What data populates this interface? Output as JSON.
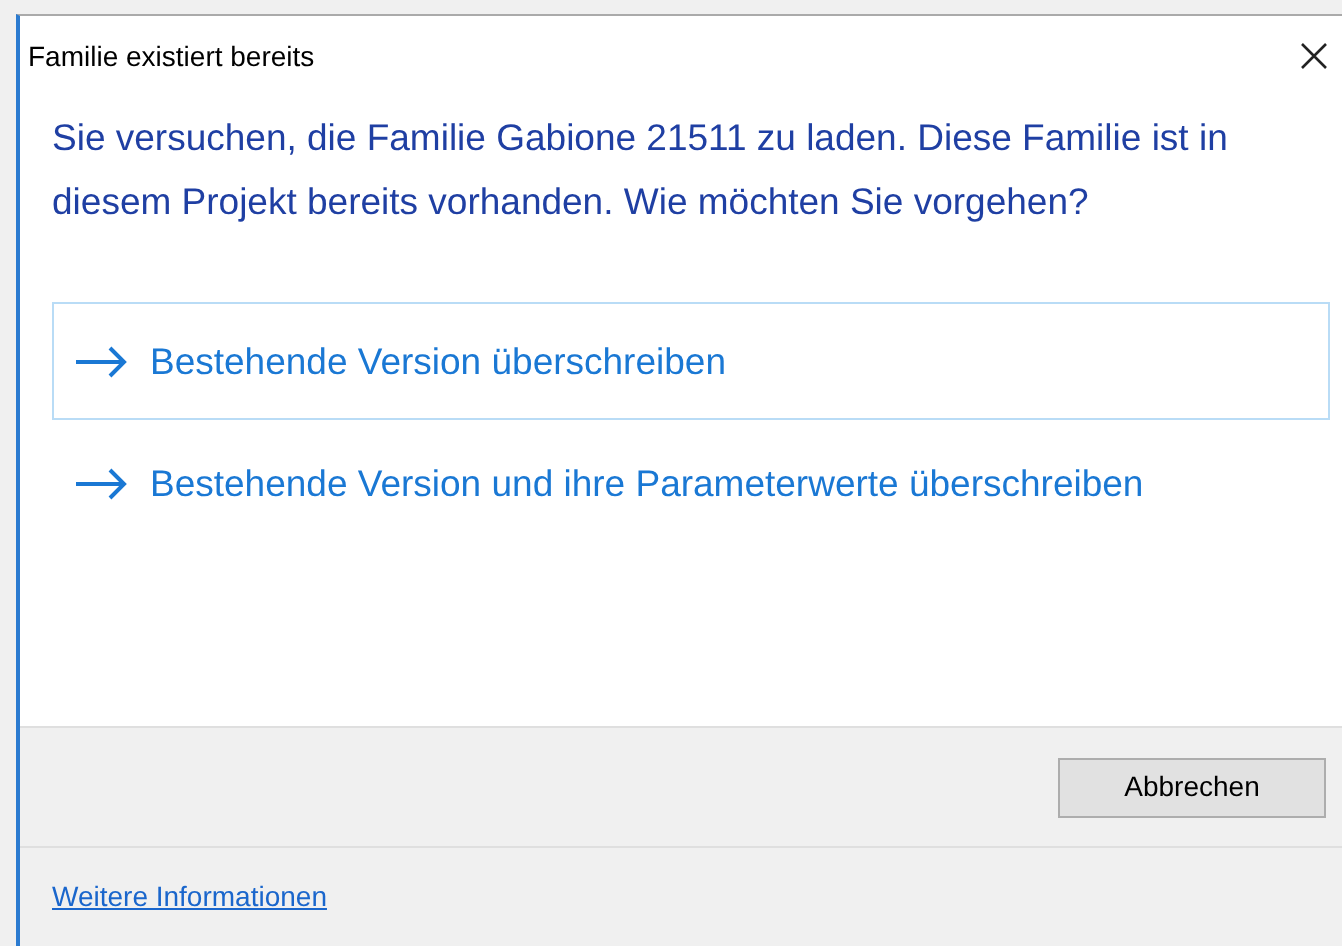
{
  "window": {
    "title": "Familie existiert bereits"
  },
  "instruction": "Sie versuchen, die Familie Gabione 21511 zu laden. Diese Familie ist in diesem Projekt bereits vorhanden. Wie möchten Sie vorgehen?",
  "options": [
    {
      "label": "Bestehende Version überschreiben",
      "selected": true
    },
    {
      "label": "Bestehende Version und ihre Parameterwerte überschreiben",
      "selected": false
    }
  ],
  "buttons": [
    "Abbrechen"
  ],
  "footer_link": "Weitere Informationen"
}
